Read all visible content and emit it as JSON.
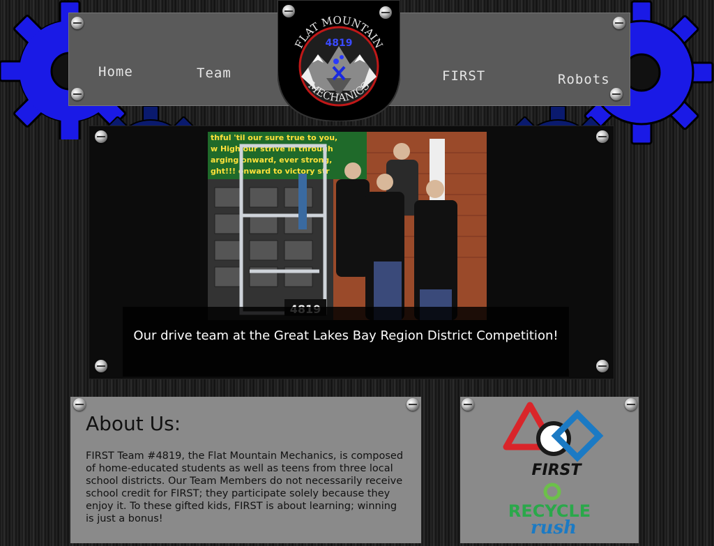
{
  "nav": {
    "home_label": "Home",
    "team_label": "Team",
    "first_label": "FIRST",
    "robots_label": "Robots"
  },
  "logo": {
    "arc_text": "FLAT MOUNTAIN",
    "number": "4819",
    "bottom_text": "MECHANICS"
  },
  "slider": {
    "caption": "Our drive team at the Great Lakes Bay Region District Competition!",
    "robot_number": "4819",
    "banner_text": [
      "thful 'til our sure true to you,",
      "w High our strive in through",
      "arging onward, ever strong,",
      "ght!!! onward to victory str"
    ]
  },
  "about": {
    "heading": "About Us:",
    "body": "FIRST Team #4819, the Flat Mountain Mechanics, is composed of home-educated students as well as teens from three local school districts. Our Team Members do not necessarily receive school credit for FIRST; they participate solely because they enjoy it. To these gifted kids, FIRST is about learning; winning is just a bonus!"
  },
  "sponsor": {
    "first_label": "FIRST",
    "recycle_label": "RECYCLE",
    "rush_label": "rush"
  },
  "colors": {
    "gear_blue": "#1a1ae6",
    "gear_navy": "#0a1a6e",
    "panel_gray": "#5a5a5a",
    "card_gray": "#8a8a8a"
  }
}
